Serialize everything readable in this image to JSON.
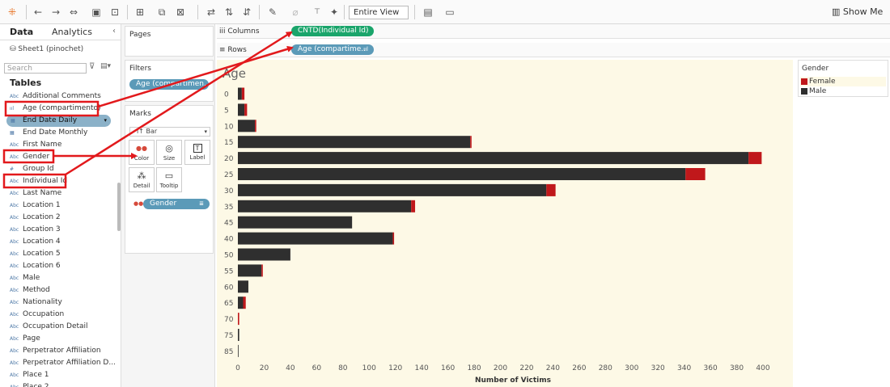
{
  "toolbar": {
    "fit": "Entire View",
    "show_me": "Show Me",
    "icons": [
      "tableau-logo-icon",
      "undo-icon",
      "redo-icon",
      "swap-icon",
      "save-icon",
      "new-datasource-icon",
      "new-worksheet-icon",
      "duplicate-icon",
      "clear-sheet-icon",
      "swap-rows-columns-icon",
      "sort-ascending-icon",
      "sort-descending-icon",
      "highlight-icon",
      "group-icon",
      "label-icon",
      "pin-icon",
      "presentation-icon"
    ]
  },
  "data_pane": {
    "tab_data": "Data",
    "tab_analytics": "Analytics",
    "source": "Sheet1 (pinochet)",
    "search_placeholder": "Search",
    "tables_header": "Tables",
    "fields": [
      {
        "type": "Abc",
        "name": "Additional Comments"
      },
      {
        "type": "ııl",
        "name": "Age (compartimento)"
      },
      {
        "type": "▦",
        "name": "End Date Daily",
        "selected": true
      },
      {
        "type": "▦",
        "name": "End Date Monthly"
      },
      {
        "type": "Abc",
        "name": "First Name"
      },
      {
        "type": "Abc",
        "name": "Gender"
      },
      {
        "type": "#",
        "name": "Group Id"
      },
      {
        "type": "Abc",
        "name": "Individual Id"
      },
      {
        "type": "Abc",
        "name": "Last Name"
      },
      {
        "type": "Abc",
        "name": "Location 1"
      },
      {
        "type": "Abc",
        "name": "Location 2"
      },
      {
        "type": "Abc",
        "name": "Location 3"
      },
      {
        "type": "Abc",
        "name": "Location 4"
      },
      {
        "type": "Abc",
        "name": "Location 5"
      },
      {
        "type": "Abc",
        "name": "Location 6"
      },
      {
        "type": "Abc",
        "name": "Male"
      },
      {
        "type": "Abc",
        "name": "Method"
      },
      {
        "type": "Abc",
        "name": "Nationality"
      },
      {
        "type": "Abc",
        "name": "Occupation"
      },
      {
        "type": "Abc",
        "name": "Occupation Detail"
      },
      {
        "type": "Abc",
        "name": "Page"
      },
      {
        "type": "Abc",
        "name": "Perpetrator Affiliation"
      },
      {
        "type": "Abc",
        "name": "Perpetrator Affiliation D..."
      },
      {
        "type": "Abc",
        "name": "Place 1"
      },
      {
        "type": "Abc",
        "name": "Place 2"
      }
    ]
  },
  "cards": {
    "pages": "Pages",
    "filters": "Filters",
    "filter_pill": "Age (compartimen..",
    "marks": "Marks",
    "mark_type": "Bar",
    "mark_buttons": [
      {
        "icon": "●●",
        "label": "Color"
      },
      {
        "icon": "◎",
        "label": "Size"
      },
      {
        "icon": "T",
        "label": "Label"
      },
      {
        "icon": "⁂",
        "label": "Detail"
      },
      {
        "icon": "▭",
        "label": "Tooltip"
      }
    ],
    "marks_pill": "Gender"
  },
  "shelves": {
    "columns_label": "Columns",
    "columns_pill": "CNTD(Individual Id)",
    "rows_label": "Rows",
    "rows_pill": "Age (compartime.."
  },
  "legend": {
    "title": "Gender",
    "items": [
      {
        "name": "Female",
        "color": "#c0181b"
      },
      {
        "name": "Male",
        "color": "#2f2f2f"
      }
    ]
  },
  "colors": {
    "male": "#2f2f2f",
    "female": "#c0181b",
    "pill_blue": "#5b9ab8",
    "pill_green": "#1aa56b",
    "view_bg": "#fdf9e6",
    "annotation": "#e2191c"
  },
  "chart_data": {
    "type": "bar",
    "orientation": "horizontal",
    "stacked": true,
    "title": "Age",
    "xlabel": "Number of Victims",
    "categories": [
      "0",
      "5",
      "10",
      "15",
      "20",
      "25",
      "30",
      "35",
      "45",
      "40",
      "50",
      "55",
      "60",
      "65",
      "70",
      "75",
      "85"
    ],
    "series": [
      {
        "name": "Male",
        "values": [
          3,
          5,
          13,
          177,
          389,
          341,
          235,
          132,
          87,
          118,
          40,
          18,
          8,
          4,
          0,
          1,
          0.5
        ]
      },
      {
        "name": "Female",
        "values": [
          2,
          2,
          1,
          1,
          10,
          15,
          7,
          3,
          0,
          1,
          0,
          1,
          0,
          2,
          1,
          0,
          0
        ]
      }
    ],
    "xlim": [
      0,
      400
    ],
    "xticks": [
      0,
      20,
      40,
      60,
      80,
      100,
      120,
      140,
      160,
      180,
      200,
      220,
      240,
      260,
      280,
      300,
      320,
      340,
      360,
      380,
      400
    ],
    "grid": false
  }
}
